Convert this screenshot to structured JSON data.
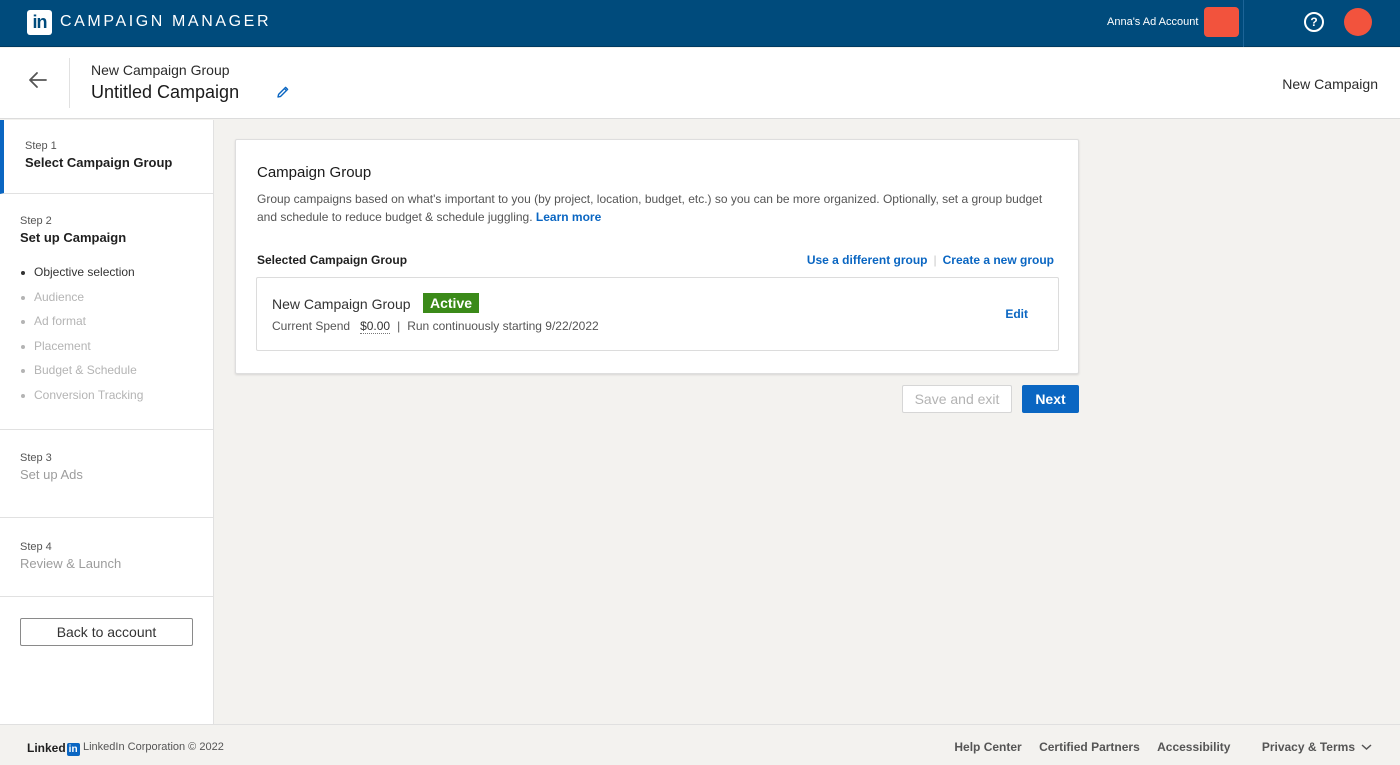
{
  "topbar": {
    "logo_text": "in",
    "app_title": "CAMPAIGN MANAGER",
    "account_name": "Anna's Ad Account",
    "account_color": "#f2533d",
    "help_icon": "?"
  },
  "header": {
    "label": "New Campaign Group",
    "title": "Untitled Campaign",
    "right_label": "New Campaign"
  },
  "sidebar": {
    "step1": {
      "num": "Step 1",
      "name": "Select Campaign Group"
    },
    "step2": {
      "num": "Step 2",
      "name": "Set up Campaign",
      "substeps": [
        "Objective selection",
        "Audience",
        "Ad format",
        "Placement",
        "Budget & Schedule",
        "Conversion Tracking"
      ]
    },
    "step3": {
      "num": "Step 3",
      "name": "Set up Ads"
    },
    "step4": {
      "num": "Step 4",
      "name": "Review & Launch"
    },
    "back_button": "Back to account"
  },
  "card": {
    "title": "Campaign Group",
    "description": "Group campaigns based on what's important to you (by project, location, budget, etc.) so you can be more organized. Optionally, set a group budget and schedule to reduce budget & schedule juggling.",
    "learn_more": "Learn more",
    "selected_label": "Selected Campaign Group",
    "use_different": "Use a different group",
    "create_new": "Create a new group",
    "group": {
      "name": "New Campaign Group",
      "status": "Active",
      "status_color": "#3b8a19",
      "spend_label": "Current Spend",
      "spend_value": "$0.00",
      "schedule": "Run continuously starting 9/22/2022",
      "edit": "Edit"
    }
  },
  "actions": {
    "save_exit": "Save and exit",
    "next": "Next"
  },
  "footer": {
    "logo_word": "Linked",
    "logo_in": "in",
    "copyright": "LinkedIn Corporation © 2022",
    "links": [
      "Help Center",
      "Certified Partners",
      "Accessibility",
      "Privacy & Terms"
    ]
  },
  "colors": {
    "topbar": "#004b7c",
    "accent": "#0a66c2",
    "active_badge": "#3b8a19"
  }
}
